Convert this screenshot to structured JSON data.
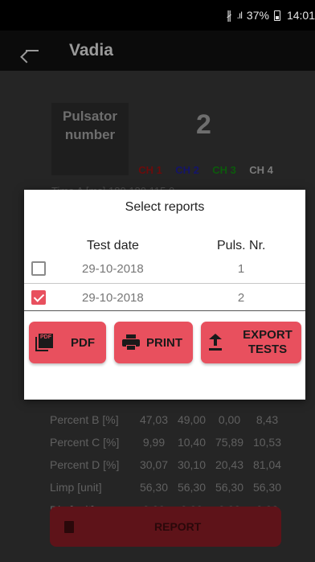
{
  "status_bar": {
    "bluetooth_icon": "bluetooth-icon",
    "signal": ".ıl",
    "battery": "37%",
    "time": "14:01"
  },
  "app_bar": {
    "title": "Vadia",
    "back_icon": "back-arrow-icon"
  },
  "background": {
    "pulsator_label_line1": "Pulsator",
    "pulsator_label_line2": "number",
    "pulsator_number": "2",
    "channels": [
      "CH 1",
      "CH 2",
      "CH 3",
      "CH 4"
    ],
    "channel_colors": [
      "#6b0b0b",
      "#14146a",
      "#0c5a0c",
      "#7a7a7a"
    ],
    "partial_row": "Time A [ms]   180   180   115   0",
    "rows": [
      {
        "label": "Percent B [%]",
        "values": [
          "47,03",
          "49,00",
          "0,00",
          "8,43"
        ]
      },
      {
        "label": "Percent C [%]",
        "values": [
          "9,99",
          "10,40",
          "75,89",
          "10,53"
        ]
      },
      {
        "label": "Percent D [%]",
        "values": [
          "30,07",
          "30,10",
          "20,43",
          "81,04"
        ]
      },
      {
        "label": "Limp [unit]",
        "values": [
          "56,30",
          "56,30",
          "56,30",
          "56,30"
        ]
      },
      {
        "label": "Dip [unit]",
        "values": [
          "0,00",
          "0,00",
          "0,00",
          "0,00"
        ]
      }
    ],
    "report_button": "REPORT"
  },
  "dialog": {
    "title": "Select reports",
    "col_test_date": "Test date",
    "col_puls_nr": "Puls. Nr.",
    "reports": [
      {
        "date": "29-10-2018",
        "puls": "1",
        "checked": false
      },
      {
        "date": "29-10-2018",
        "puls": "2",
        "checked": true
      }
    ],
    "actions": {
      "pdf": "PDF",
      "print": "PRINT",
      "export_line1": "EXPORT",
      "export_line2": "TESTS"
    },
    "accent_color": "#e8505e"
  }
}
